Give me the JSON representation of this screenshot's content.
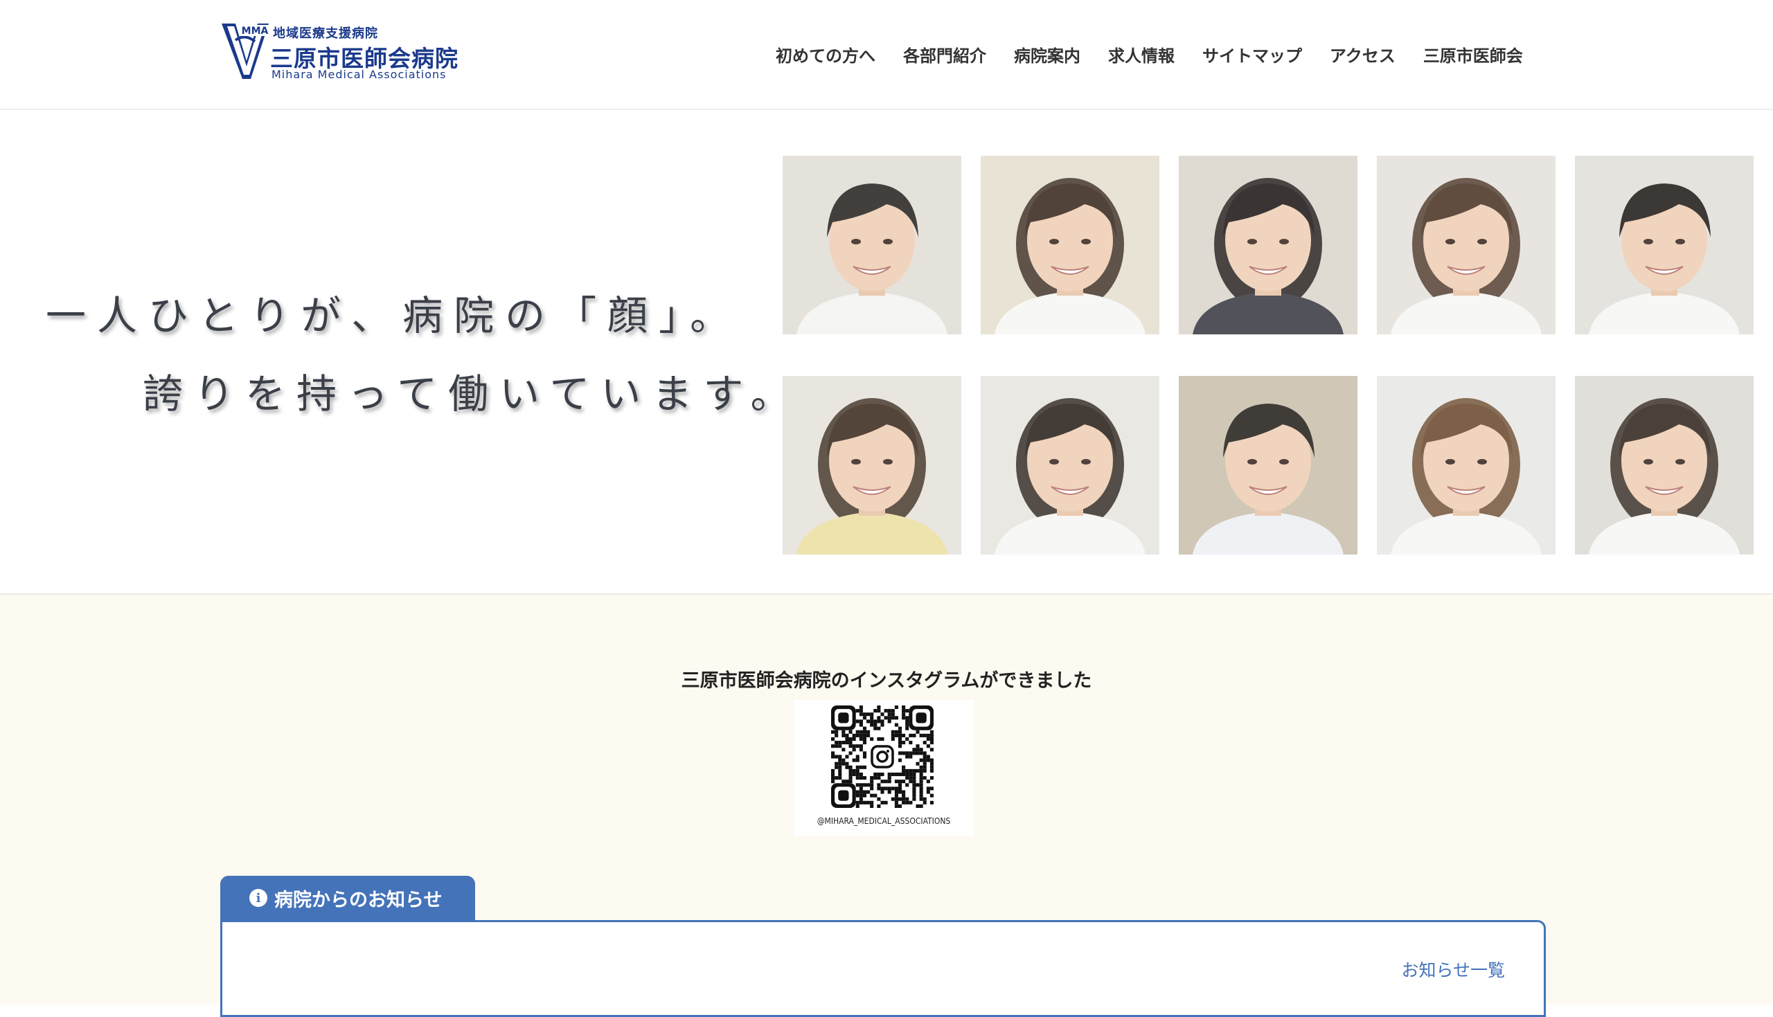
{
  "header": {
    "logo_mark": "MMA",
    "logo_subtitle": "地域医療支援病院",
    "logo_title": "三原市医師会病院",
    "logo_en": "Mihara Medical Associations",
    "nav": [
      "初めての方へ",
      "各部門紹介",
      "病院案内",
      "求人情報",
      "サイトマップ",
      "アクセス",
      "三原市医師会"
    ]
  },
  "hero": {
    "line1": "一人ひとりが、病院の「顔」。",
    "line2": "誇りを持って働いています。",
    "faces": [
      {
        "hair": "#2a2521",
        "shirt": "#f4f4f2",
        "bg": "#d8d4ca",
        "long": false
      },
      {
        "hair": "#3a2a1f",
        "shirt": "#f6f6f4",
        "bg": "#ddd6bf",
        "long": true
      },
      {
        "hair": "#1f1a18",
        "shirt": "#3b3b44",
        "bg": "#cfc9bd",
        "long": true
      },
      {
        "hair": "#4a3526",
        "shirt": "#f6f6f4",
        "bg": "#dcd9d0",
        "long": true
      },
      {
        "hair": "#221d1a",
        "shirt": "#f6f6f4",
        "bg": "#d9d6cc",
        "long": false
      },
      {
        "hair": "#3d2c20",
        "shirt": "#ece0a2",
        "bg": "#dedad0",
        "long": true
      },
      {
        "hair": "#2b221c",
        "shirt": "#f6f6f4",
        "bg": "#e0dcd3",
        "long": true
      },
      {
        "hair": "#26211d",
        "shirt": "#eef0f4",
        "bg": "#b9ab90",
        "long": false
      },
      {
        "hair": "#6b4a2e",
        "shirt": "#f6f6f4",
        "bg": "#e1e0dc",
        "long": true
      },
      {
        "hair": "#33271f",
        "shirt": "#f6f6f4",
        "bg": "#d2cfc6",
        "long": true
      }
    ]
  },
  "instagram": {
    "title": "三原市医師会病院のインスタグラムができました",
    "handle": "@MIHARA_MEDICAL_ASSOCIATIONS"
  },
  "news": {
    "tab_label": "病院からのお知らせ",
    "info_icon": "i",
    "list_link": "お知らせ一覧"
  },
  "colors": {
    "brand": "#1b3a8c",
    "accent": "#4473b9",
    "content_bg": "#fdfaf1"
  }
}
